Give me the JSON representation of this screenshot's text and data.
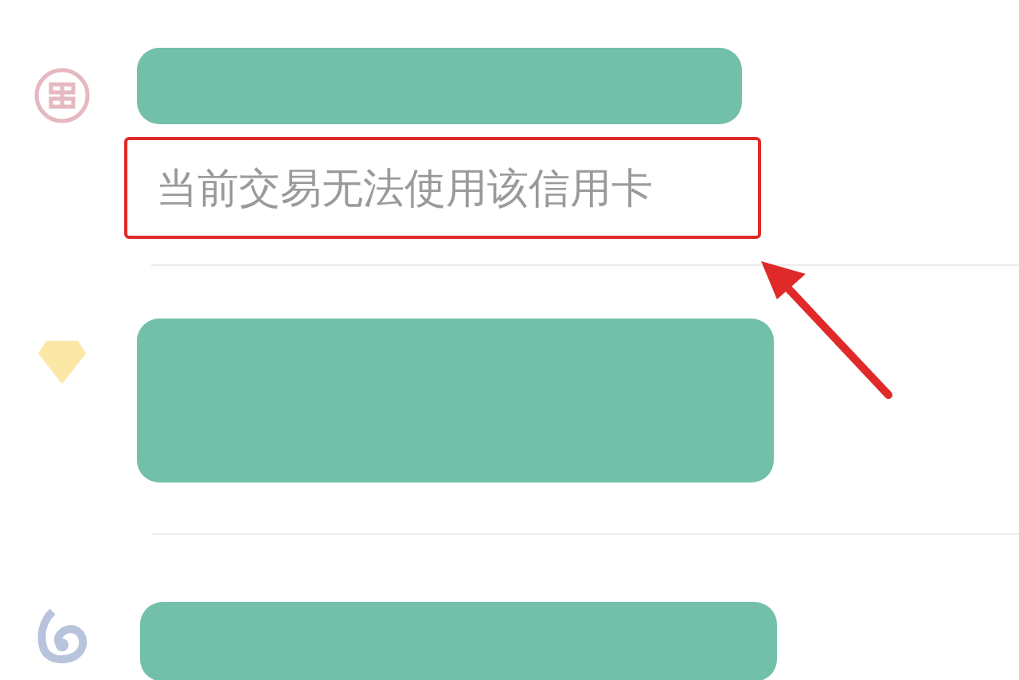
{
  "accounts": [
    {
      "kind": "round-bank",
      "message": "当前交易无法使用该信用卡"
    },
    {
      "kind": "gem"
    },
    {
      "kind": "swirl"
    }
  ]
}
